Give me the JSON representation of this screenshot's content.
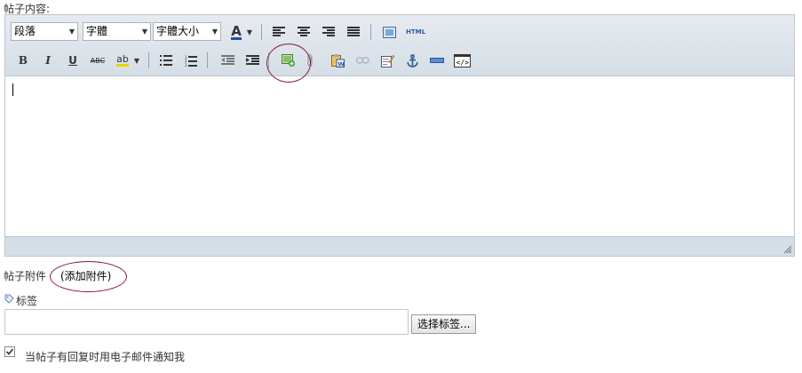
{
  "labels": {
    "post_content": "帖子内容:",
    "post_attachment": "帖子附件",
    "add_attachment": "(添加附件)",
    "tags": "标签",
    "choose_tags_button": "选择标签...",
    "notify_email": "当帖子有回复时用电子邮件通知我"
  },
  "editor": {
    "format_select": "段落",
    "font_select": "字體",
    "size_select": "字體大小",
    "row1": {
      "font_color": "A",
      "html_label": "HTML"
    },
    "row2": {
      "bold": "B",
      "italic": "I",
      "underline": "U",
      "strikethrough": "ABC",
      "highlight": "ab"
    }
  },
  "notify_checked": true,
  "colors": {
    "annotation_circle": "#8b1a3a",
    "toolbar_bg": "#dce3ea",
    "border": "#b9c6d2"
  }
}
